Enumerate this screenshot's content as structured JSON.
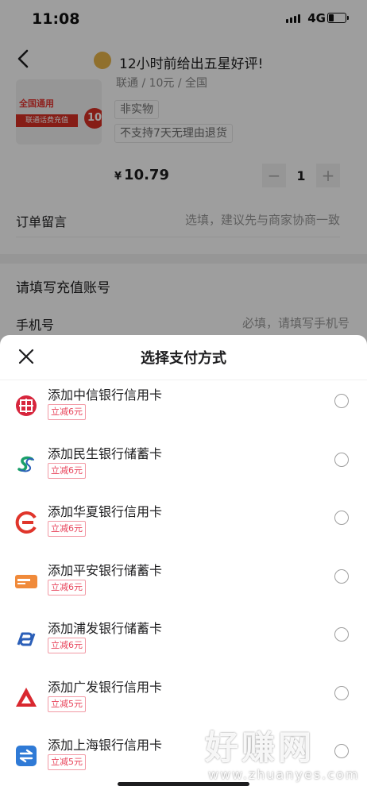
{
  "status_bar": {
    "time": "11:08",
    "network": "4G"
  },
  "header": {
    "review_banner": "12小时前给出五星好评!"
  },
  "product": {
    "image_text_1": "全国通用",
    "image_text_2": "联通话费充值",
    "image_text_3": "10",
    "spec_line": "联通 / 10元 / 全国",
    "tags": [
      "非实物",
      "不支持7天无理由退货"
    ],
    "price_symbol": "¥",
    "price": "10.79",
    "quantity": "1",
    "minus": "−",
    "plus": "+"
  },
  "remark": {
    "label": "订单留言",
    "placeholder": "选填，建议先与商家协商一致"
  },
  "recharge": {
    "title": "请填写充值账号",
    "phone_label": "手机号",
    "phone_placeholder": "必填，请填写手机号"
  },
  "payment_sheet": {
    "title": "选择支付方式",
    "items": [
      {
        "name": "添加中信银行信用卡",
        "badge": "立减6元",
        "icon": "citic-bank-icon",
        "color": "#d7263d"
      },
      {
        "name": "添加民生银行储蓄卡",
        "badge": "立减6元",
        "icon": "minsheng-bank-icon",
        "color": "#1a9f6a"
      },
      {
        "name": "添加华夏银行信用卡",
        "badge": "立减6元",
        "icon": "huaxia-bank-icon",
        "color": "#e0352b"
      },
      {
        "name": "添加平安银行储蓄卡",
        "badge": "立减6元",
        "icon": "pingan-bank-icon",
        "color": "#f08a3a"
      },
      {
        "name": "添加浦发银行储蓄卡",
        "badge": "立减6元",
        "icon": "spdb-bank-icon",
        "color": "#2b5fb8"
      },
      {
        "name": "添加广发银行信用卡",
        "badge": "立减5元",
        "icon": "cgb-bank-icon",
        "color": "#d9282f"
      },
      {
        "name": "添加上海银行信用卡",
        "badge": "立减5元",
        "icon": "bank-of-shanghai-icon",
        "color": "#2f7ad6"
      }
    ]
  },
  "watermark": {
    "text": "好赚网",
    "url": "www.zhuanyes.com"
  }
}
